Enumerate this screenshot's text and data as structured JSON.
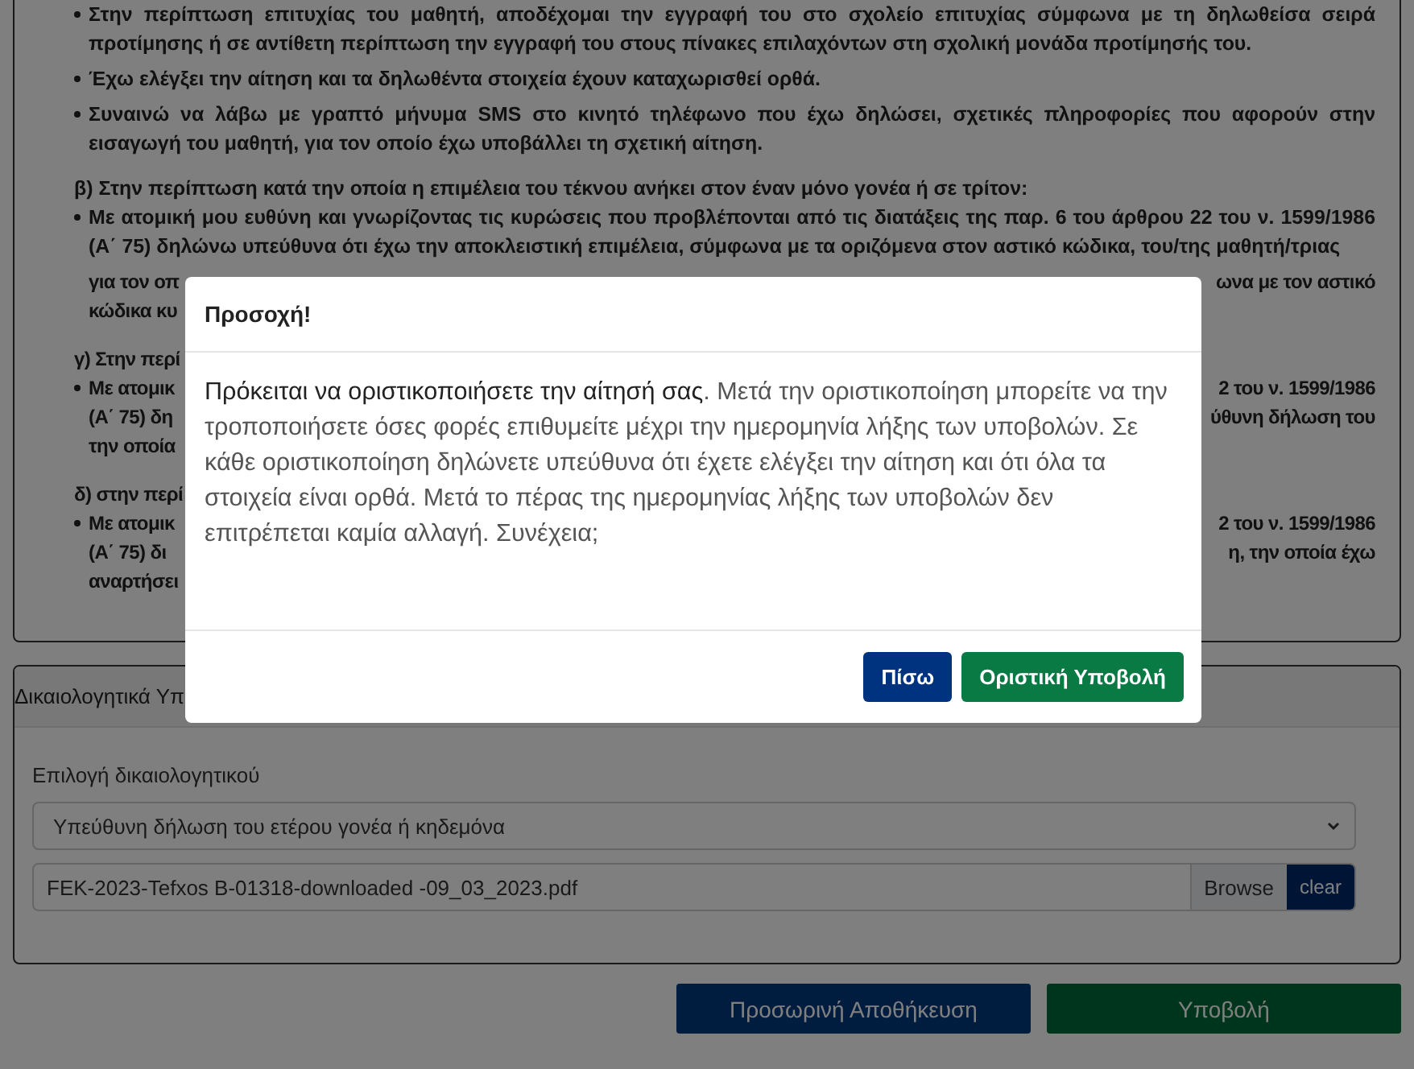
{
  "declarations": [
    {
      "kind": "bullet",
      "text": "Στην περίπτωση επιτυχίας του μαθητή, αποδέχομαι την εγγραφή του στο σχολείο επιτυχίας σύμφωνα με τη δηλωθείσα σειρά προτίμησης ή σε αντίθετη περίπτωση την εγγραφή του στους πίνακες επιλαχόντων στη σχολική μονάδα προτίμησής του."
    },
    {
      "kind": "bullet",
      "text": "Έχω ελέγξει την αίτηση και τα δηλωθέντα στοιχεία έχουν καταχωρισθεί ορθά."
    },
    {
      "kind": "bullet",
      "text": "Συναινώ να λάβω με γραπτό μήνυμα SMS στο κινητό τηλέφωνο που έχω δηλώσει, σχετικές πληροφορίες που αφορούν στην εισαγωγή του μαθητή, για τον οποίο έχω υποβάλλει τη σχετική αίτηση."
    },
    {
      "kind": "heading",
      "text": "β) Στην περίπτωση κατά την οποία η επιμέλεια του τέκνου ανήκει στον έναν μόνο γονέα ή σε τρίτον:"
    },
    {
      "kind": "bullet",
      "text": "Με ατομική μου ευθύνη και γνωρίζοντας τις κυρώσεις που προβλέπονται από τις διατάξεις της παρ. 6 του άρθρου 22 του ν. 1599/1986 (Α΄ 75) δηλώνω υπεύθυνα ότι έχω την αποκλειστική επιμέλεια, σύμφωνα με τα οριζόμενα στον αστικό κώδικα, του/της μαθητή/τριας"
    },
    {
      "kind": "split",
      "bullet": false,
      "left": "για τον οπ",
      "right": "ωνα με τον αστικό"
    },
    {
      "kind": "split",
      "bullet": false,
      "left": "κώδικα κυ"
    },
    {
      "kind": "gap"
    },
    {
      "kind": "heading_fragment",
      "text": "γ) Στην περί"
    },
    {
      "kind": "split",
      "bullet": true,
      "left": "Με ατομικ",
      "right": "2 του ν. 1599/1986"
    },
    {
      "kind": "split",
      "bullet": false,
      "left": "(Α΄ 75) δη",
      "right": "ύθυνη δήλωση του"
    },
    {
      "kind": "split",
      "bullet": false,
      "left": "την οποία"
    },
    {
      "kind": "gap"
    },
    {
      "kind": "heading_fragment",
      "text": "δ) στην περί"
    },
    {
      "kind": "split",
      "bullet": true,
      "left": "Με ατομικ",
      "right": "2 του ν. 1599/1986"
    },
    {
      "kind": "split",
      "bullet": false,
      "left": "(Α΄ 75) δι",
      "right": "η, την οποία έχω"
    },
    {
      "kind": "split",
      "bullet": false,
      "left": "αναρτήσει"
    }
  ],
  "documents_panel": {
    "title": "Δικαιολογητικά Υπ",
    "select_label": "Επιλογή δικαιολογητικού",
    "select_value": "Υπεύθυνη δήλωση του ετέρου γονέα ή κηδεμόνα",
    "file_name": "FEK-2023-Tefxos B-01318-downloaded -09_03_2023.pdf",
    "browse": "Browse",
    "clear": "clear"
  },
  "actions": [
    "Προσωρινή Αποθήκευση",
    "Υποβολή"
  ],
  "modal": {
    "title": "Προσοχή!",
    "message": "**Πρόκειται να οριστικοποιήσετε την αίτησή σας**. Μετά την οριστικοποίηση μπορείτε να την τροποποιήσετε όσες φορές επιθυμείτε μέχρι την ημερομηνία λήξης των υποβολών. Σε κάθε οριστικοποίηση δηλώνετε υπεύθυνα ότι έχετε ελέγξει την αίτηση και ότι όλα τα στοιχεία είναι ορθά. Μετά το πέρας της ημερομηνίας λήξης των υποβολών δεν επιτρέπεται καμία αλλαγή. Συνέχεια;",
    "buttons": [
      {
        "label": "Πίσω",
        "kind": "secondary"
      },
      {
        "label": "Οριστική Υποβολή",
        "kind": "primary"
      }
    ]
  }
}
